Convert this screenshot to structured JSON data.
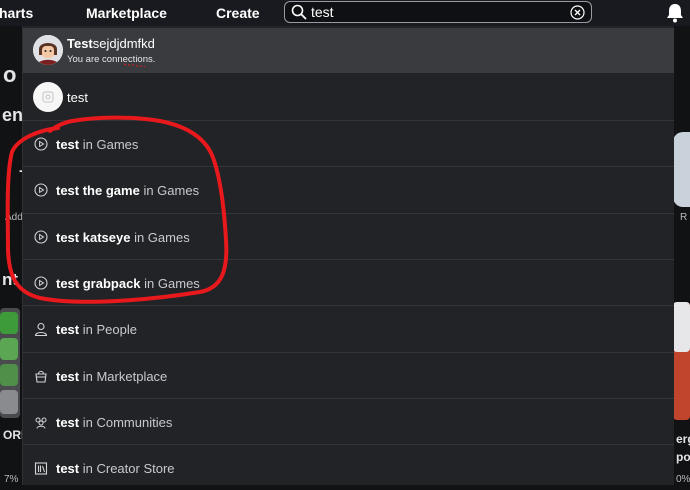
{
  "nav": {
    "charts_label": "harts",
    "marketplace_label": "Marketplace",
    "create_label": "Create"
  },
  "search": {
    "query": "test"
  },
  "background": {
    "frag_1": "o",
    "frag_2": "en",
    "frag_3": "Add",
    "frag_4": "nt",
    "frag_5": "ORD",
    "frag_6": "7%",
    "frag_7": "R",
    "frag_8": "erg",
    "frag_9": "po",
    "frag_10": "0%"
  },
  "dropdown": {
    "user_result": {
      "name_bold": "Test",
      "name_rest": "sejdjdmfkd",
      "subtitle": "You are connections."
    },
    "game_result": {
      "label": "test"
    },
    "suggestions": [
      {
        "query": "test",
        "scope": "in Games",
        "icon": "play-circle-icon"
      },
      {
        "query": "test the game",
        "scope": "in Games",
        "icon": "play-circle-icon"
      },
      {
        "query": "test katseye",
        "scope": "in Games",
        "icon": "play-circle-icon"
      },
      {
        "query": "test grabpack",
        "scope": "in Games",
        "icon": "play-circle-icon"
      },
      {
        "query": "test",
        "scope": "in People",
        "icon": "person-icon"
      },
      {
        "query": "test",
        "scope": "in Marketplace",
        "icon": "shopping-bag-icon"
      },
      {
        "query": "test",
        "scope": "in Communities",
        "icon": "group-icon"
      },
      {
        "query": "test",
        "scope": "in Creator Store",
        "icon": "library-icon"
      }
    ]
  },
  "colors": {
    "dropdown_bg": "#222326",
    "highlight_row": "#393b3f",
    "annotation_red": "#e8191c"
  }
}
